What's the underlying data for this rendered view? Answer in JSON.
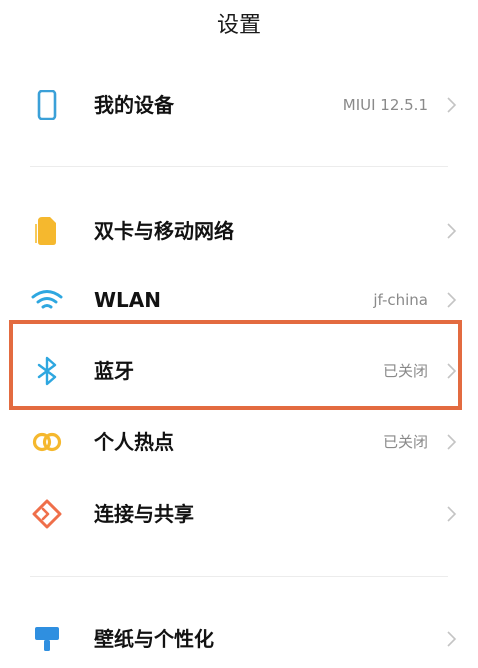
{
  "header": {
    "title": "设置"
  },
  "settings": {
    "items": [
      {
        "label": "我的设备",
        "value": "MIUI 12.5.1",
        "icon": "phone-device-icon"
      },
      {
        "label": "双卡与移动网络",
        "value": "",
        "icon": "sim-card-icon"
      },
      {
        "label": "WLAN",
        "value": "jf-china",
        "icon": "wifi-icon"
      },
      {
        "label": "蓝牙",
        "value": "已关闭",
        "icon": "bluetooth-icon"
      },
      {
        "label": "个人热点",
        "value": "已关闭",
        "icon": "hotspot-icon"
      },
      {
        "label": "连接与共享",
        "value": "",
        "icon": "connection-share-icon"
      },
      {
        "label": "壁纸与个性化",
        "value": "",
        "icon": "wallpaper-icon"
      }
    ]
  },
  "colors": {
    "highlight_border": "#e36b40",
    "device_icon": "#3aa0d8",
    "sim_icon": "#f5b82e",
    "wifi_icon": "#2ea7e0",
    "bluetooth_icon": "#2ea7e0",
    "hotspot_icon": "#f5b82e",
    "connection_icon": "#ef6f4a",
    "wallpaper_icon": "#2f8fe0"
  }
}
